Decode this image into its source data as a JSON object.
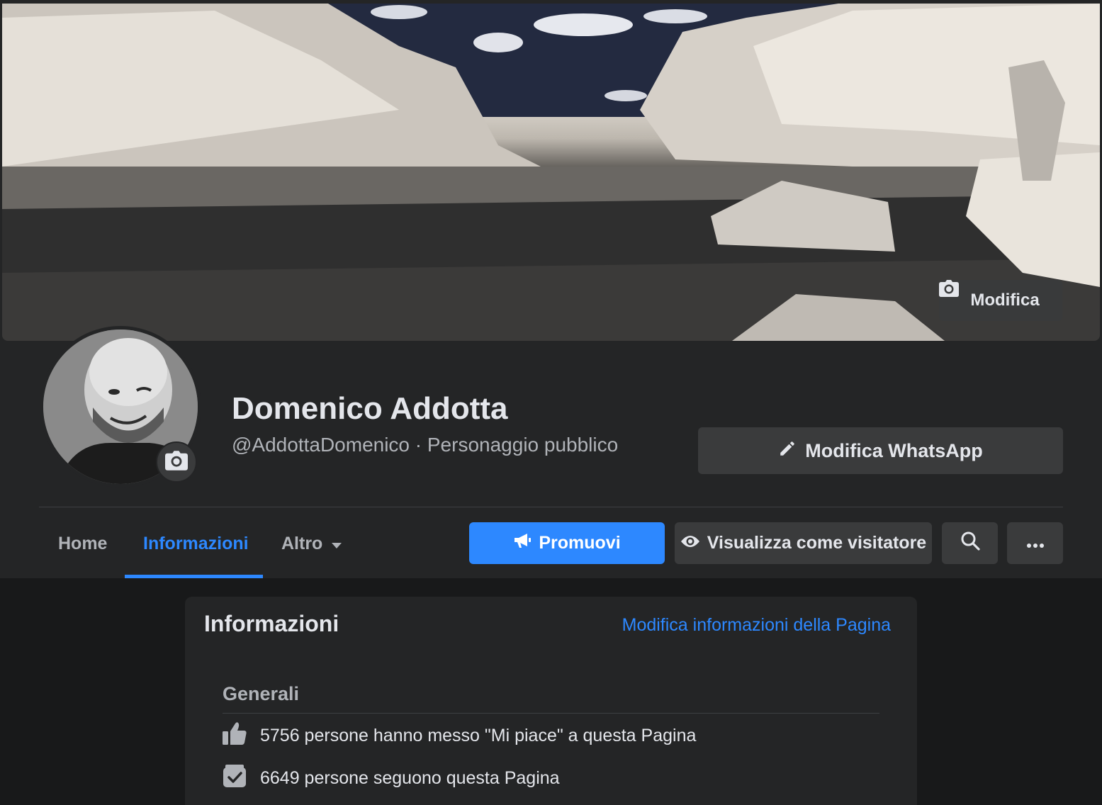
{
  "cover": {
    "edit_label": "Modifica"
  },
  "profile": {
    "name": "Domenico Addotta",
    "subtitle": "@AddottaDomenico · Personaggio pubblico",
    "whatsapp_label": "Modifica WhatsApp"
  },
  "tabs": [
    {
      "label": "Home",
      "active": false
    },
    {
      "label": "Informazioni",
      "active": true
    },
    {
      "label": "Altro",
      "active": false
    }
  ],
  "actions": {
    "promote_label": "Promuovi",
    "visitor_label": "Visualizza come visitatore"
  },
  "about": {
    "title": "Informazioni",
    "edit_link": "Modifica informazioni della Pagina",
    "section_title": "Generali",
    "likes_text": "5756 persone hanno messo \"Mi piace\" a questa Pagina",
    "followers_text": "6649 persone seguono questa Pagina"
  },
  "icons": {
    "cover_edit": "camera-icon",
    "avatar_edit": "camera-icon",
    "whatsapp_edit": "pencil-icon",
    "altro": "caret-down-icon",
    "promote": "megaphone-icon",
    "visitor": "eye-icon",
    "search": "search-icon",
    "more": "more-dots-icon",
    "likes": "thumbs-up-icon",
    "followers": "follow-check-icon"
  },
  "colors": {
    "accent": "#2d88ff",
    "surface": "#242526",
    "background": "#18191a",
    "button": "#3a3b3c"
  }
}
